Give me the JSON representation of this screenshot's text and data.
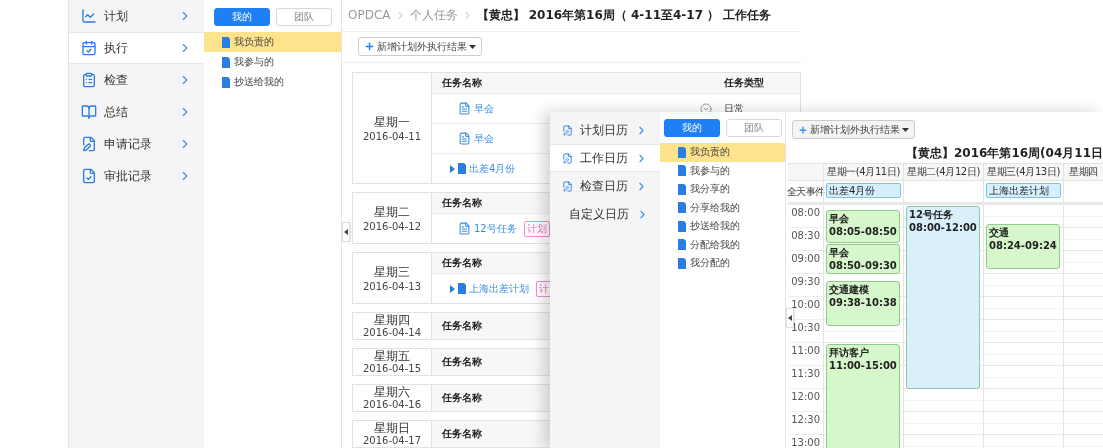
{
  "nav": [
    {
      "label": "计划",
      "kind": "chart",
      "selected": false
    },
    {
      "label": "执行",
      "kind": "calendar",
      "selected": true
    },
    {
      "label": "检查",
      "kind": "list",
      "selected": false
    },
    {
      "label": "总结",
      "kind": "book",
      "selected": false
    },
    {
      "label": "申请记录",
      "kind": "apply",
      "selected": false
    },
    {
      "label": "审批记录",
      "kind": "approve",
      "selected": false
    }
  ],
  "filter_tabs": [
    {
      "label": "我的",
      "selected": true
    },
    {
      "label": "团队",
      "selected": false
    }
  ],
  "filter_items": [
    {
      "label": "我负责的",
      "selected": true
    },
    {
      "label": "我参与的",
      "selected": false
    },
    {
      "label": "抄送给我的",
      "selected": false
    }
  ],
  "breadcrumb": [
    "OPDCA",
    "个人任务"
  ],
  "title": "【黄忠】 2016年第16周（ 4-11至4-17 ） 工作任务",
  "add_button": "新增计划外执行结果",
  "days": [
    {
      "day": "星期一",
      "date": "2016-04-11",
      "name_header": "任务名称",
      "type_header": "任务类型",
      "tasks": [
        {
          "kind": "doc",
          "name": "早会",
          "type": "日常"
        },
        {
          "kind": "doc",
          "name": "早会"
        },
        {
          "kind": "folder",
          "name": "出差4月份"
        }
      ]
    },
    {
      "day": "星期二",
      "date": "2016-04-12",
      "name_header": "任务名称",
      "tasks": [
        {
          "kind": "doc",
          "name": "12号任务",
          "tag": "计划"
        }
      ]
    },
    {
      "day": "星期三",
      "date": "2016-04-13",
      "name_header": "任务名称",
      "tasks": [
        {
          "kind": "folder",
          "name": "上海出差计划",
          "tag": "计"
        }
      ]
    },
    {
      "day": "星期四",
      "date": "2016-04-14",
      "name_header": "任务名称"
    },
    {
      "day": "星期五",
      "date": "2016-04-15",
      "name_header": "任务名称"
    },
    {
      "day": "星期六",
      "date": "2016-04-16",
      "name_header": "任务名称"
    },
    {
      "day": "星期日",
      "date": "2016-04-17",
      "name_header": "任务名称"
    }
  ],
  "calendar_window": {
    "nav": [
      {
        "label": "计划日历",
        "selected": false
      },
      {
        "label": "工作日历",
        "selected": true
      },
      {
        "label": "检查日历",
        "selected": false
      },
      {
        "label": "自定义日历",
        "selected": false
      }
    ],
    "filter_tabs": [
      {
        "label": "我的",
        "selected": true
      },
      {
        "label": "团队",
        "selected": false
      }
    ],
    "filter_items": [
      {
        "label": "我负责的",
        "selected": true
      },
      {
        "label": "我参与的",
        "selected": false
      },
      {
        "label": "我分享的",
        "selected": false
      },
      {
        "label": "分享给我的",
        "selected": false
      },
      {
        "label": "抄送给我的",
        "selected": false
      },
      {
        "label": "分配给我的",
        "selected": false
      },
      {
        "label": "我分配的",
        "selected": false
      }
    ],
    "add_button": "新增计划外执行结果",
    "title": "【黄忠】2016年第16周(04月11日",
    "all_day_label": "全天事件",
    "times": [
      "08:00",
      "08:30",
      "09:00",
      "09:30",
      "10:00",
      "10:30",
      "11:00",
      "11:30",
      "12:00",
      "12:30",
      "13:00"
    ],
    "days": [
      {
        "header": "星期一(4月11日)",
        "all_day": [
          "出差4月份"
        ],
        "events": [
          {
            "title": "早会",
            "time": "08:05-08:50",
            "color": "#d6f7cc"
          },
          {
            "title": "早会",
            "time": "08:50-09:30",
            "color": "#d6f7cc"
          },
          {
            "title": "交通建模",
            "time": "09:38-10:38",
            "color": "#d6f7cc"
          },
          {
            "title": "拜访客户",
            "time": "11:00-15:00",
            "color": "#d6f7cc"
          }
        ]
      },
      {
        "header": "星期二(4月12日)",
        "events": [
          {
            "title": "12号任务",
            "time": "08:00-12:00",
            "color": "#d9effc"
          }
        ]
      },
      {
        "header": "星期三(4月13日)",
        "all_day": [
          "上海出差计划"
        ],
        "events": [
          {
            "title": "交通",
            "time": "08:24-09:24",
            "color": "#d6f7cc"
          }
        ]
      },
      {
        "header": "星期四"
      }
    ]
  }
}
